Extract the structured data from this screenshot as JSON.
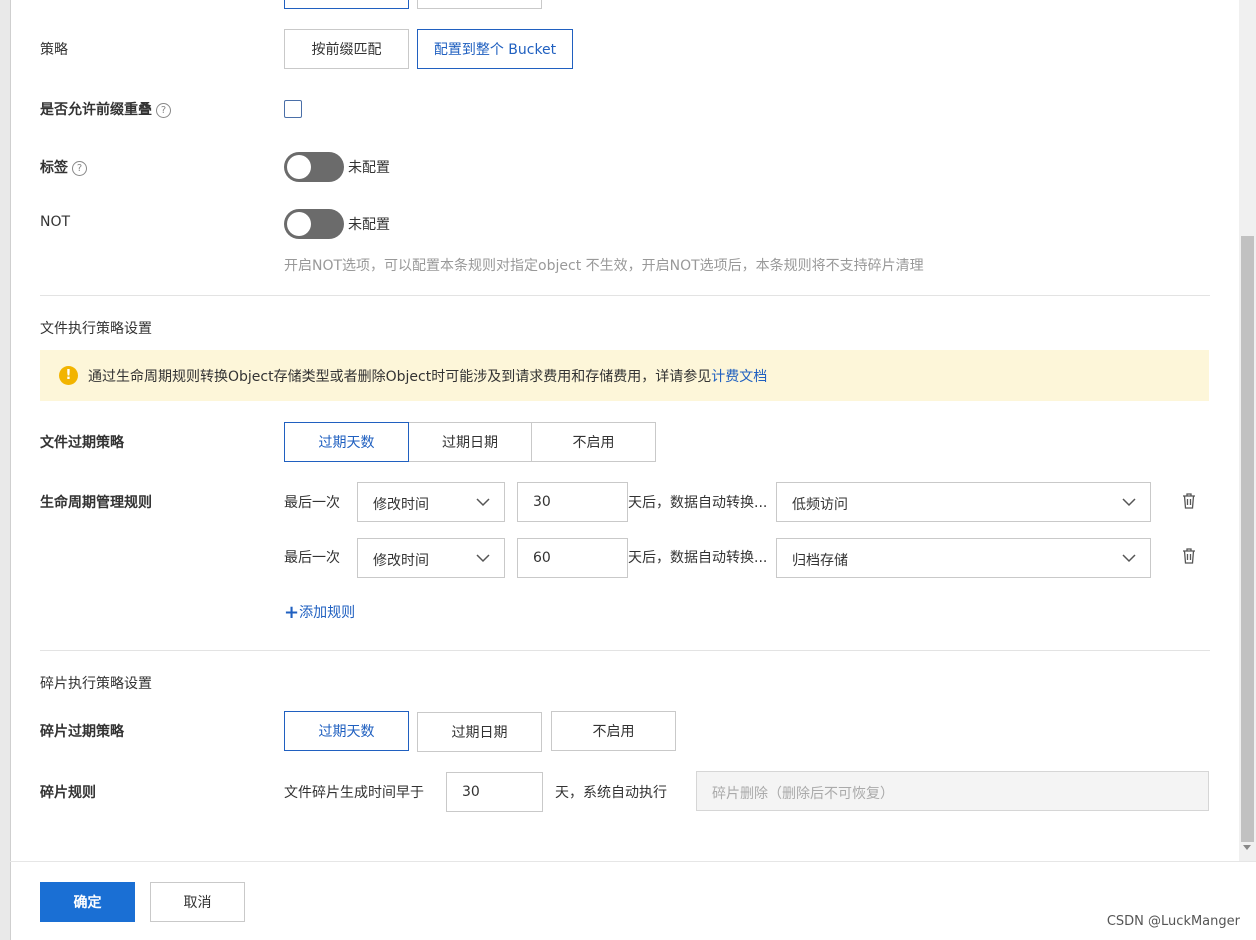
{
  "strategy": {
    "label": "策略",
    "options": [
      "按前缀匹配",
      "配置到整个 Bucket"
    ],
    "selected": "配置到整个 Bucket"
  },
  "prefix_overlap": {
    "label": "是否允许前缀重叠",
    "help_icon": "help-circle-icon",
    "checked": false
  },
  "tags": {
    "label": "标签",
    "help_icon": "help-circle-icon",
    "toggle_text": "未配置",
    "on": false
  },
  "not": {
    "label": "NOT",
    "toggle_text": "未配置",
    "on": false,
    "hint": "开启NOT选项，可以配置本条规则对指定object 不生效，开启NOT选项后，本条规则将不支持碎片清理"
  },
  "file_section": {
    "title": "文件执行策略设置",
    "notice_text": "通过生命周期规则转换Object存储类型或者删除Object时可能涉及到请求费用和存储费用，详请参见",
    "notice_link": "计费文档",
    "expire_label": "文件过期策略",
    "expire_options": [
      "过期天数",
      "过期日期",
      "不启用"
    ],
    "expire_selected": "过期天数",
    "rules_label": "生命周期管理规则",
    "rules": [
      {
        "prefix": "最后一次",
        "time_field": "修改时间",
        "days": "30",
        "middle": "天后，数据自动转换...",
        "target": "低频访问"
      },
      {
        "prefix": "最后一次",
        "time_field": "修改时间",
        "days": "60",
        "middle": "天后，数据自动转换...",
        "target": "归档存储"
      }
    ],
    "add_rule": "添加规则"
  },
  "fragment_section": {
    "title": "碎片执行策略设置",
    "expire_label": "碎片过期策略",
    "expire_options": [
      "过期天数",
      "过期日期",
      "不启用"
    ],
    "expire_selected": "过期天数",
    "rule_label": "碎片规则",
    "rule_prefix": "文件碎片生成时间早于",
    "days": "30",
    "rule_suffix": "天，系统自动执行",
    "action_placeholder": "碎片删除（删除后不可恢复）"
  },
  "footer": {
    "ok": "确定",
    "cancel": "取消"
  },
  "watermark": "CSDN @LuckManger",
  "colors": {
    "accent": "#2060c0",
    "primary_button": "#1a6fd4",
    "notice_bg": "#fdf6d9",
    "warning": "#f2b400"
  }
}
